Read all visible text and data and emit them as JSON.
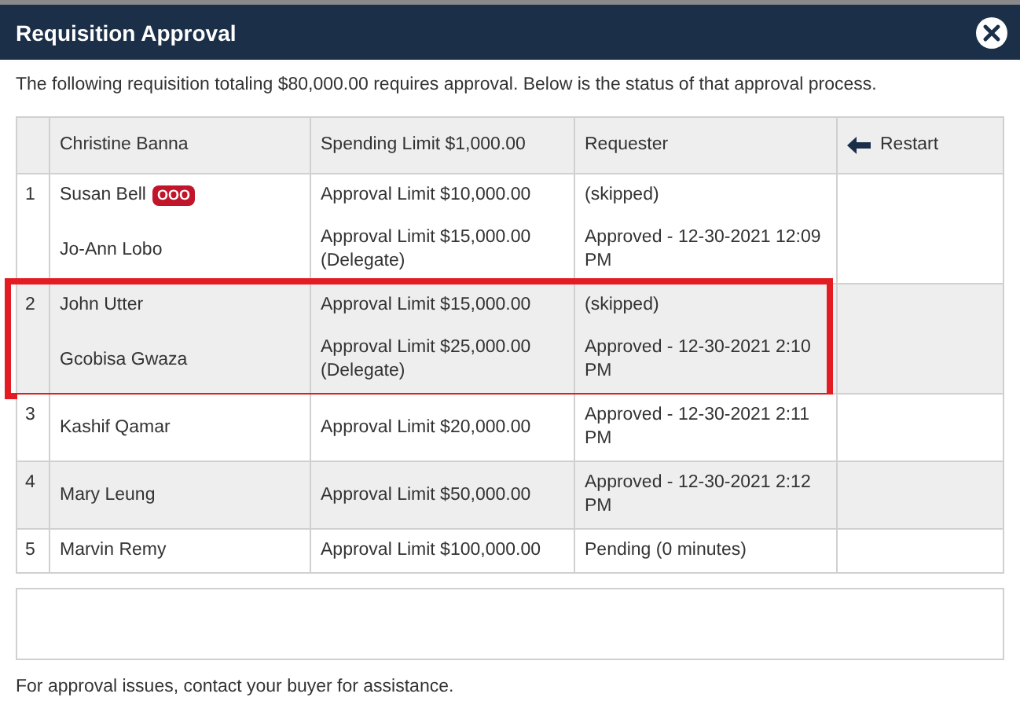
{
  "dialog": {
    "title": "Requisition Approval"
  },
  "intro": "The following requisition totaling $80,000.00 requires approval. Below is the status of that approval process.",
  "table": {
    "header": {
      "requester_name": "Christine Banna",
      "spending_limit": "Spending Limit $1,000.00",
      "role": "Requester",
      "restart": "Restart"
    },
    "steps": [
      {
        "number": "1",
        "highlighted": false,
        "approvers": [
          {
            "name": "Susan Bell",
            "badge": "OOO",
            "limit": "Approval Limit $10,000.00",
            "status": "(skipped)"
          },
          {
            "name": "Jo-Ann Lobo",
            "limit": "Approval Limit $15,000.00 (Delegate)",
            "status": "Approved - 12-30-2021 12:09 PM"
          }
        ]
      },
      {
        "number": "2",
        "highlighted": true,
        "approvers": [
          {
            "name": "John Utter",
            "limit": "Approval Limit $15,000.00",
            "status": "(skipped)"
          },
          {
            "name": "Gcobisa Gwaza",
            "limit": "Approval Limit $25,000.00 (Delegate)",
            "status": "Approved - 12-30-2021 2:10 PM"
          }
        ]
      },
      {
        "number": "3",
        "highlighted": false,
        "approvers": [
          {
            "name": "Kashif Qamar",
            "limit": "Approval Limit $20,000.00",
            "status": "Approved - 12-30-2021 2:11 PM"
          }
        ]
      },
      {
        "number": "4",
        "highlighted": false,
        "approvers": [
          {
            "name": "Mary Leung",
            "limit": "Approval Limit $50,000.00",
            "status": "Approved - 12-30-2021 2:12 PM"
          }
        ]
      },
      {
        "number": "5",
        "highlighted": false,
        "approvers": [
          {
            "name": "Marvin Remy",
            "limit": "Approval Limit $100,000.00",
            "status": "Pending (0 minutes)"
          }
        ]
      }
    ]
  },
  "footer": "For approval issues, contact your buyer for assistance."
}
